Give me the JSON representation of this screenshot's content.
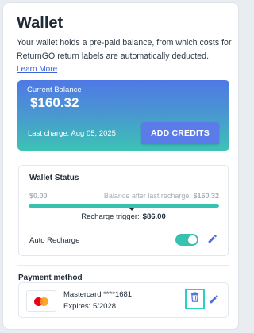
{
  "wallet": {
    "title": "Wallet",
    "description": "Your wallet holds a pre-paid balance, from which costs for ReturnGO return labels are automatically deducted.",
    "learn_more": "Learn More"
  },
  "balance": {
    "label": "Current Balance",
    "amount": "$160.32",
    "last_charge": "Last charge: Aug 05, 2025",
    "add_credits_label": "ADD CREDITS"
  },
  "status": {
    "heading": "Wallet Status",
    "min_label": "$0.00",
    "after_label": "Balance after last recharge:",
    "after_value": "$160.32",
    "trigger_label": "Recharge trigger:",
    "trigger_value": "$86.00",
    "progress_fraction": 1.0,
    "trigger_fraction": 0.54,
    "auto_recharge_label": "Auto Recharge",
    "auto_recharge_on": true
  },
  "payment": {
    "heading": "Payment method",
    "card_name": "Mastercard ****1681",
    "expires": "Expires: 5/2028"
  },
  "colors": {
    "accent": "#5b7be8",
    "teal": "#37c2b0",
    "focus": "#2ad0c0"
  },
  "icons": [
    "edit-icon",
    "trash-icon",
    "mastercard-logo"
  ]
}
